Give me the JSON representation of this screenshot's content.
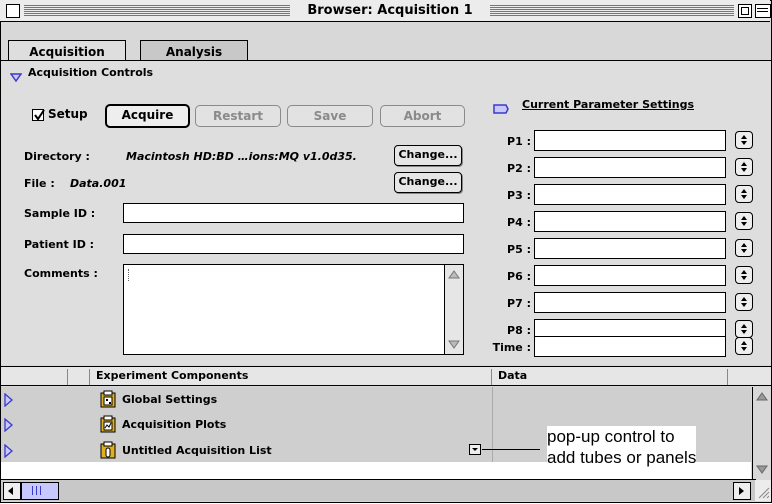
{
  "window": {
    "title": "Browser: Acquisition 1"
  },
  "tabs": [
    {
      "label": "Acquisition",
      "active": true
    },
    {
      "label": "Analysis",
      "active": false
    }
  ],
  "section": {
    "title": "Acquisition Controls"
  },
  "controls": {
    "setup_label": "Setup",
    "setup_checked": true,
    "acquire_label": "Acquire",
    "restart_label": "Restart",
    "save_label": "Save",
    "abort_label": "Abort"
  },
  "fields": {
    "directory_label": "Directory :",
    "directory_value": "Macintosh HD:BD …ions:MQ v1.0d35.",
    "directory_change_label": "Change...",
    "file_label": "File :",
    "file_value": "Data.001",
    "file_change_label": "Change...",
    "sample_id_label": "Sample ID :",
    "sample_id_value": "",
    "patient_id_label": "Patient ID :",
    "patient_id_value": "",
    "comments_label": "Comments :",
    "comments_value": ""
  },
  "parameters": {
    "header": "Current Parameter Settings",
    "items": [
      {
        "label": "P1 :",
        "value": ""
      },
      {
        "label": "P2 :",
        "value": ""
      },
      {
        "label": "P3 :",
        "value": ""
      },
      {
        "label": "P4 :",
        "value": ""
      },
      {
        "label": "P5 :",
        "value": ""
      },
      {
        "label": "P6 :",
        "value": ""
      },
      {
        "label": "P7 :",
        "value": ""
      },
      {
        "label": "P8 :",
        "value": ""
      },
      {
        "label": "Time :",
        "value": ""
      }
    ]
  },
  "list": {
    "columns": [
      "Experiment Components",
      "Data"
    ],
    "rows": [
      {
        "name": "Global Settings",
        "icon": "global-settings-icon"
      },
      {
        "name": "Acquisition Plots",
        "icon": "acquisition-plots-icon"
      },
      {
        "name": "Untitled Acquisition List",
        "icon": "acquisition-list-icon"
      }
    ]
  },
  "annotation": {
    "line1": "pop-up control to",
    "line2": "add tubes or panels"
  },
  "colors": {
    "accent": "#3a3ac8",
    "icon_yellow": "#e0b020"
  }
}
